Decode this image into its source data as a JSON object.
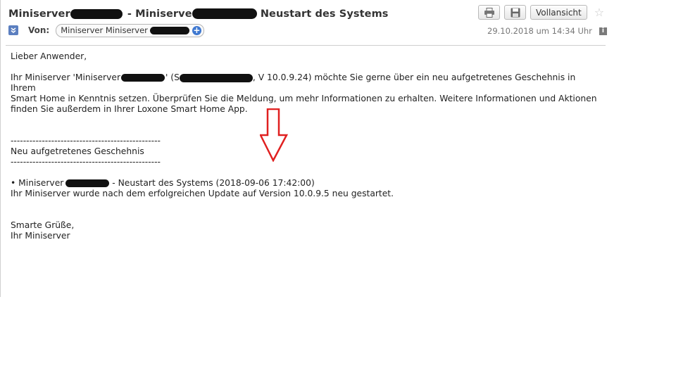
{
  "header": {
    "subject_part1": "Miniserver",
    "subject_sep": " - Miniserve",
    "subject_part2": " Neustart des Systems",
    "print_icon": "printer-icon",
    "save_icon": "floppy-disk-icon",
    "fullview_label": "Vollansicht",
    "star_icon": "star-icon"
  },
  "meta": {
    "from_label": "Von:",
    "from_name": "Miniserver Miniserver",
    "date": "29.10.2018 um 14:34 Uhr"
  },
  "body": {
    "greeting": "Lieber Anwender,",
    "intro_pre": "Ihr Miniserver 'Miniserver",
    "intro_mid": "' (S",
    "intro_post": ", V 10.0.9.24) möchte Sie gerne über ein neu aufgetretenes Geschehnis in Ihrem",
    "intro_line2": "Smart Home in Kenntnis setzen. Überprüfen Sie die Meldung, um mehr Informationen zu erhalten. Weitere Informationen und Aktionen",
    "intro_line3": "finden Sie außerdem in Ihrer Loxone Smart Home App.",
    "dashes": "------------------------------------------------",
    "section_title": "Neu aufgetretenes Geschehnis",
    "event_pre": "• Miniserver",
    "event_post": " - Neustart des Systems (2018-09-06 17:42:00)",
    "event_detail": "Ihr Miniserver wurde nach dem erfolgreichen Update auf Version 10.0.9.5 neu gestartet.",
    "closing1": "Smarte Grüße,",
    "closing2": "Ihr Miniserver"
  },
  "colors": {
    "annotation_arrow": "#e02020",
    "accent_blue": "#3f78d0"
  }
}
